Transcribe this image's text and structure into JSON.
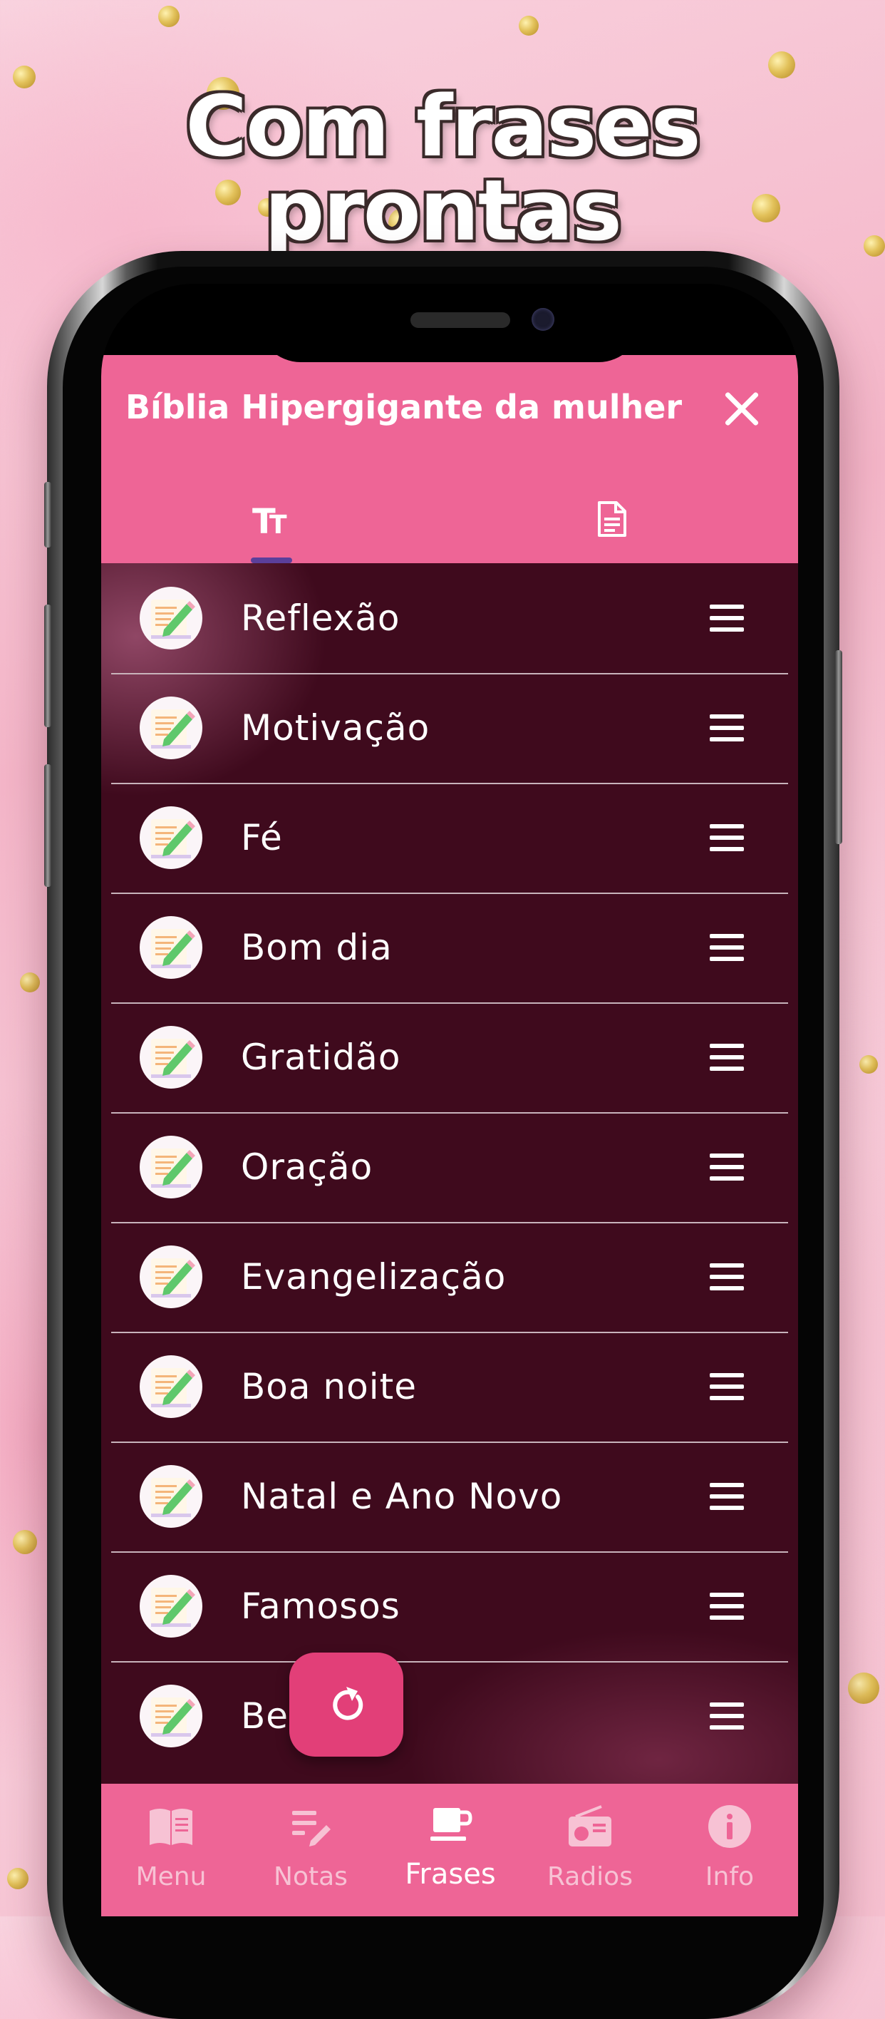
{
  "headline": "Com frases prontas",
  "app": {
    "title": "Bíblia Hipergigante da mulher"
  },
  "tabs": [
    {
      "icon": "text-size-icon",
      "active": true
    },
    {
      "icon": "document-icon",
      "active": false
    }
  ],
  "categories": [
    {
      "label": "Reflexão"
    },
    {
      "label": "Motivação"
    },
    {
      "label": "Fé"
    },
    {
      "label": "Bom dia"
    },
    {
      "label": "Gratidão"
    },
    {
      "label": "Oração"
    },
    {
      "label": "Evangelização"
    },
    {
      "label": "Boa noite"
    },
    {
      "label": "Natal e Ano Novo"
    },
    {
      "label": "Famosos"
    },
    {
      "label": "Benção"
    }
  ],
  "fab": {
    "icon": "refresh-icon"
  },
  "bottom_nav": [
    {
      "label": "Menu",
      "icon": "book-icon"
    },
    {
      "label": "Notas",
      "icon": "notes-icon"
    },
    {
      "label": "Frases",
      "icon": "coffee-cup-icon",
      "active": true
    },
    {
      "label": "Radios",
      "icon": "radio-icon"
    },
    {
      "label": "Info",
      "icon": "info-icon"
    }
  ],
  "colors": {
    "header": "#ee6596",
    "list_background": "#3f0a1d",
    "fab": "#e23f78",
    "tab_indicator": "#5b3f9b"
  }
}
